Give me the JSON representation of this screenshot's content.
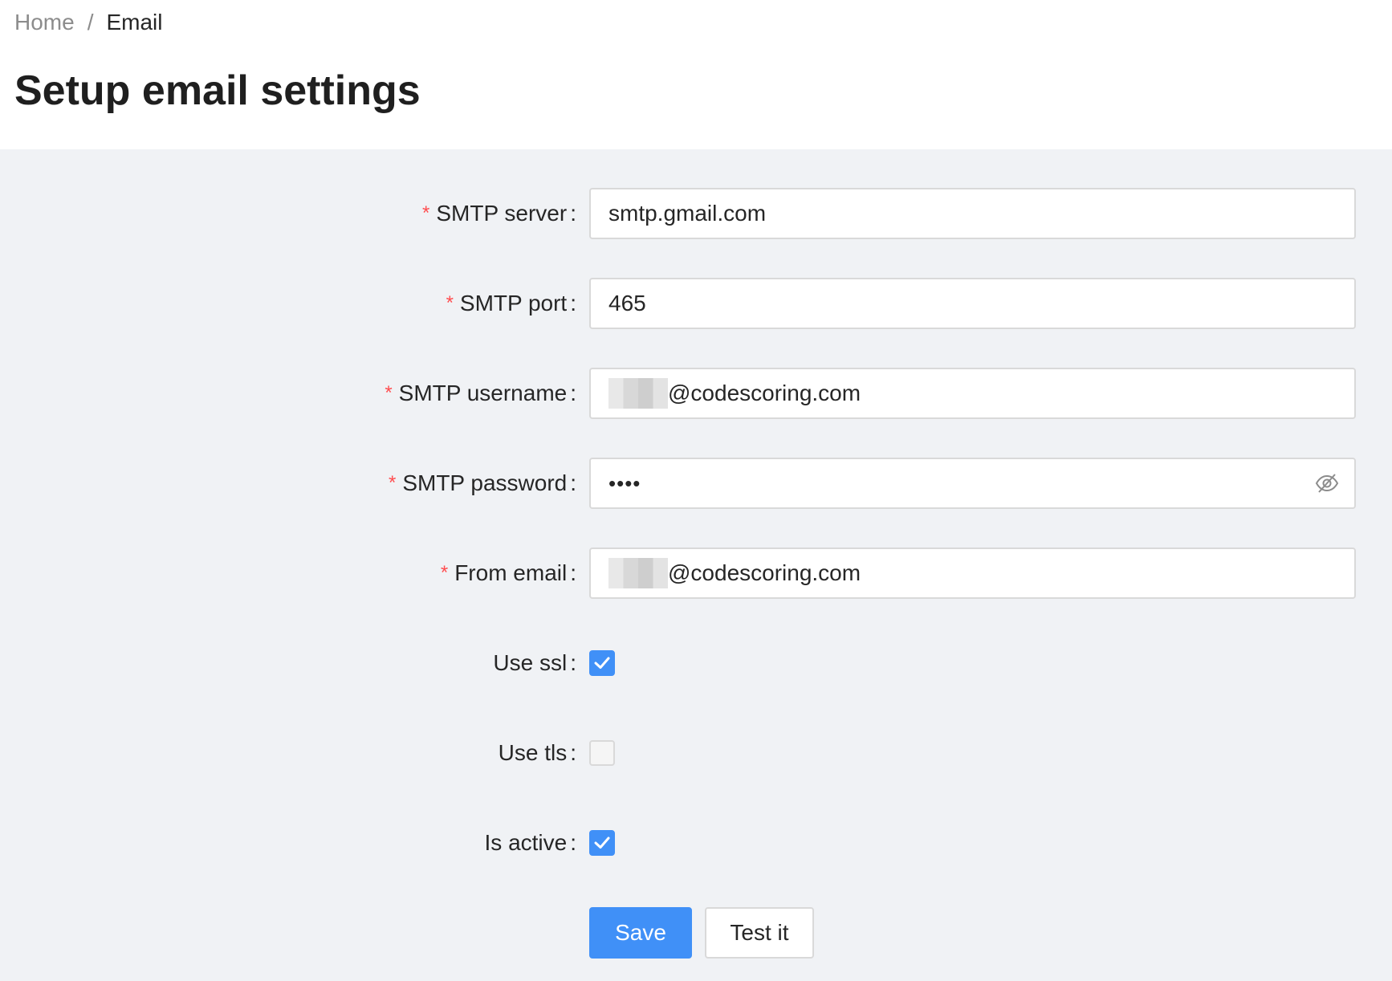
{
  "breadcrumb": {
    "home": "Home",
    "separator": "/",
    "current": "Email"
  },
  "page": {
    "title": "Setup email settings"
  },
  "form": {
    "smtp_server": {
      "label": "SMTP server",
      "value": "smtp.gmail.com",
      "required": true
    },
    "smtp_port": {
      "label": "SMTP port",
      "value": "465",
      "required": true
    },
    "smtp_username": {
      "label": "SMTP username",
      "value_suffix": "@codescoring.com",
      "required": true
    },
    "smtp_password": {
      "label": "SMTP password",
      "masked_value": "••••",
      "toggle_icon": "eye-invisible-icon",
      "required": true
    },
    "from_email": {
      "label": "From email",
      "value_suffix": "@codescoring.com",
      "required": true
    },
    "use_ssl": {
      "label": "Use ssl",
      "checked": true
    },
    "use_tls": {
      "label": "Use tls",
      "checked": false
    },
    "is_active": {
      "label": "Is active",
      "checked": true
    },
    "required_mark": "*",
    "colon": ":"
  },
  "actions": {
    "save_label": "Save",
    "test_label": "Test it"
  },
  "colors": {
    "primary": "#4090f7",
    "required": "#ff4d4f",
    "background": "#f0f2f5"
  }
}
